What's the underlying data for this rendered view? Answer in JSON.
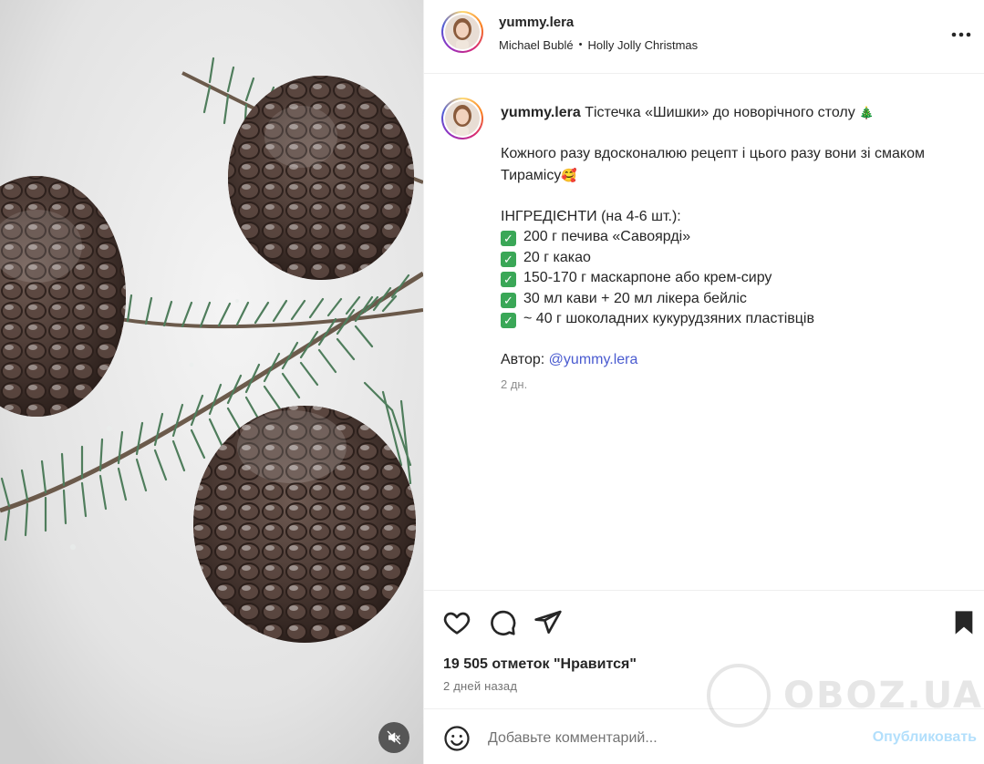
{
  "post": {
    "username": "yummy.lera",
    "music": {
      "artist": "Michael Bublé",
      "separator": "•",
      "track": "Holly Jolly Christmas"
    }
  },
  "caption": {
    "username": "yummy.lera",
    "title": "Тістечка «Шишки» до новорічного столу",
    "title_emoji": "🎄",
    "intro_line1": "Кожного разу вдосконалюю рецепт і цього разу вони зі смаком",
    "intro_line2": "Тирамісу",
    "intro_emoji": "🥰",
    "ingredients_heading": "ІНГРЕДІЄНТИ (на 4-6 шт.):",
    "ingredients": [
      "200 г печива «Савоярді»",
      "20 г какао",
      "150-170 г маскарпоне або крем-сиру",
      "30 мл кави + 20 мл лікера бейліс",
      "~ 40 г шоколадних кукурудзяних пластівців"
    ],
    "check_glyph": "✓",
    "author_label": "Автор:",
    "author_mention": "@yummy.lera",
    "time": "2 дн."
  },
  "engagement": {
    "likes_text": "19 505 отметок \"Нравится\"",
    "posted_ago": "2 дней назад"
  },
  "comment": {
    "placeholder": "Добавьте комментарий...",
    "publish_label": "Опубликовать"
  },
  "watermark": {
    "text": "OBOZ.UA"
  },
  "colors": {
    "accent_blue_disabled": "#b2dffc",
    "mention": "#4a5bd0",
    "check_green": "#3aa757",
    "muted_text": "#737373"
  },
  "icons": [
    "more-icon",
    "heart-icon",
    "comment-icon",
    "share-icon",
    "bookmark-icon",
    "emoji-icon",
    "mute-icon"
  ]
}
